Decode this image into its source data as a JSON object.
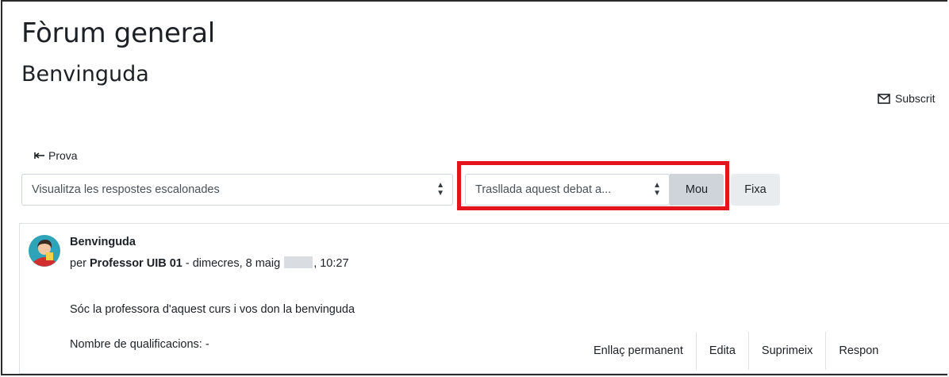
{
  "forum": {
    "title": "Fòrum general"
  },
  "discussion": {
    "title": "Benvinguda"
  },
  "subscribe": {
    "label": "Subscrit"
  },
  "navigation": {
    "previous_label": "Prova"
  },
  "display_mode": {
    "selected": "Visualitza les respostes escalonades"
  },
  "move_discussion": {
    "selected": "Trasllada aquest debat a...",
    "move_button": "Mou"
  },
  "pin_button": "Fixa",
  "post": {
    "subject": "Benvinguda",
    "meta_prefix": "per",
    "author": "Professor UIB 01",
    "date_text": " - dimecres, 8 maig ",
    "time_text": ", 10:27",
    "body": "Sóc la professora d'aquest curs i vos don la benvinguda",
    "ratings_label": "Nombre de qualificacions: -",
    "actions": [
      "Enllaç permanent",
      "Edita",
      "Suprimeix",
      "Respon"
    ]
  },
  "colors": {
    "highlight": "#e3141b",
    "button_bg": "#ced4da",
    "avatar_bg": "#2fa4b8"
  }
}
